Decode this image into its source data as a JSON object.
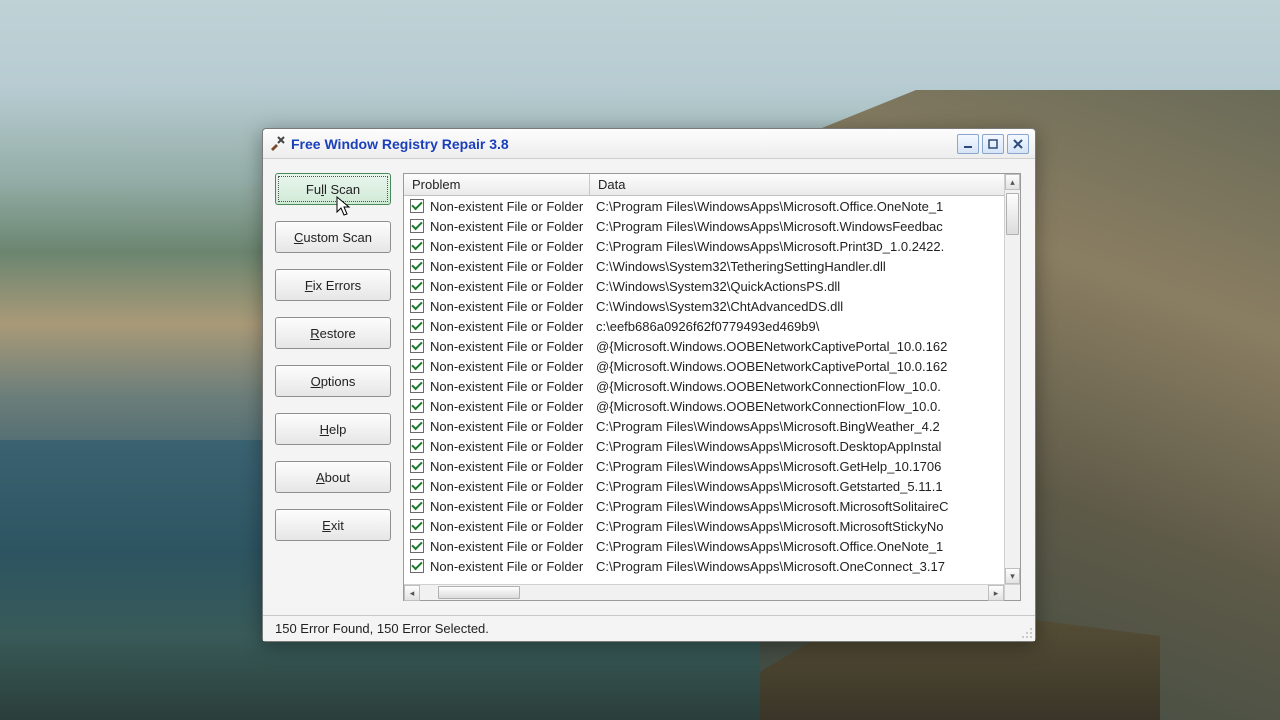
{
  "window": {
    "title": "Free Window Registry Repair 3.8"
  },
  "sidebar": {
    "buttons": [
      {
        "label": "Full Scan",
        "mnemonic_index": 2,
        "active": true
      },
      {
        "label": "Custom Scan",
        "mnemonic_index": 0,
        "active": false
      },
      {
        "label": "Fix Errors",
        "mnemonic_index": 0,
        "active": false
      },
      {
        "label": "Restore",
        "mnemonic_index": 0,
        "active": false
      },
      {
        "label": "Options",
        "mnemonic_index": 0,
        "active": false
      },
      {
        "label": "Help",
        "mnemonic_index": 0,
        "active": false
      },
      {
        "label": "About",
        "mnemonic_index": 0,
        "active": false
      },
      {
        "label": "Exit",
        "mnemonic_index": 0,
        "active": false
      }
    ]
  },
  "columns": {
    "problem": "Problem",
    "data": "Data"
  },
  "rows": [
    {
      "checked": true,
      "problem": "Non-existent File or Folder",
      "data": "C:\\Program Files\\WindowsApps\\Microsoft.Office.OneNote_1"
    },
    {
      "checked": true,
      "problem": "Non-existent File or Folder",
      "data": "C:\\Program Files\\WindowsApps\\Microsoft.WindowsFeedbac"
    },
    {
      "checked": true,
      "problem": "Non-existent File or Folder",
      "data": "C:\\Program Files\\WindowsApps\\Microsoft.Print3D_1.0.2422."
    },
    {
      "checked": true,
      "problem": "Non-existent File or Folder",
      "data": "C:\\Windows\\System32\\TetheringSettingHandler.dll"
    },
    {
      "checked": true,
      "problem": "Non-existent File or Folder",
      "data": "C:\\Windows\\System32\\QuickActionsPS.dll"
    },
    {
      "checked": true,
      "problem": "Non-existent File or Folder",
      "data": "C:\\Windows\\System32\\ChtAdvancedDS.dll"
    },
    {
      "checked": true,
      "problem": "Non-existent File or Folder",
      "data": "c:\\eefb686a0926f62f0779493ed469b9\\"
    },
    {
      "checked": true,
      "problem": "Non-existent File or Folder",
      "data": "@{Microsoft.Windows.OOBENetworkCaptivePortal_10.0.162"
    },
    {
      "checked": true,
      "problem": "Non-existent File or Folder",
      "data": "@{Microsoft.Windows.OOBENetworkCaptivePortal_10.0.162"
    },
    {
      "checked": true,
      "problem": "Non-existent File or Folder",
      "data": "@{Microsoft.Windows.OOBENetworkConnectionFlow_10.0."
    },
    {
      "checked": true,
      "problem": "Non-existent File or Folder",
      "data": "@{Microsoft.Windows.OOBENetworkConnectionFlow_10.0."
    },
    {
      "checked": true,
      "problem": "Non-existent File or Folder",
      "data": "C:\\Program Files\\WindowsApps\\Microsoft.BingWeather_4.2"
    },
    {
      "checked": true,
      "problem": "Non-existent File or Folder",
      "data": "C:\\Program Files\\WindowsApps\\Microsoft.DesktopAppInstal"
    },
    {
      "checked": true,
      "problem": "Non-existent File or Folder",
      "data": "C:\\Program Files\\WindowsApps\\Microsoft.GetHelp_10.1706"
    },
    {
      "checked": true,
      "problem": "Non-existent File or Folder",
      "data": "C:\\Program Files\\WindowsApps\\Microsoft.Getstarted_5.11.1"
    },
    {
      "checked": true,
      "problem": "Non-existent File or Folder",
      "data": "C:\\Program Files\\WindowsApps\\Microsoft.MicrosoftSolitaireC"
    },
    {
      "checked": true,
      "problem": "Non-existent File or Folder",
      "data": "C:\\Program Files\\WindowsApps\\Microsoft.MicrosoftStickyNo"
    },
    {
      "checked": true,
      "problem": "Non-existent File or Folder",
      "data": "C:\\Program Files\\WindowsApps\\Microsoft.Office.OneNote_1"
    },
    {
      "checked": true,
      "problem": "Non-existent File or Folder",
      "data": "C:\\Program Files\\WindowsApps\\Microsoft.OneConnect_3.17"
    }
  ],
  "status": "150 Error Found,  150 Error Selected."
}
